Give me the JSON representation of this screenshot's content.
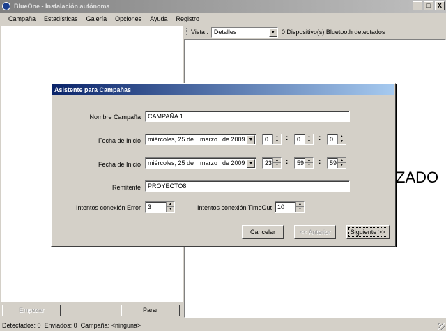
{
  "window": {
    "title": "BlueOne - Instalación autónoma",
    "controls": [
      "_",
      "□",
      "X"
    ]
  },
  "menu": [
    "Campaña",
    "Estadísticas",
    "Galería",
    "Opciones",
    "Ayuda",
    "Registro"
  ],
  "left_panel": {
    "start_button": "Empezar",
    "stop_button": "Parar"
  },
  "toolbar": {
    "vista_label": "Vista :",
    "vista_value": "Detalles",
    "devices_text": "0 Dispositivo(s) Bluetooth detectados"
  },
  "right_panel": {
    "background_text": "ZADO"
  },
  "dialog": {
    "title": "Asistente para Campañas",
    "nombre_label": "Nombre Campaña",
    "nombre_value": "CAMPAÑA 1",
    "fecha_inicio_label": "Fecha de Inicio",
    "fecha_inicio": {
      "weekday": "miércoles, 25 de",
      "month": "marzo",
      "year": "de 2009",
      "hour": "0",
      "minute": "0",
      "second": "0"
    },
    "fecha_fin_label": "Fecha de Inicio",
    "fecha_fin": {
      "weekday": "miércoles, 25 de",
      "month": "marzo",
      "year": "de 2009",
      "hour": "23",
      "minute": "59",
      "second": "59"
    },
    "remitente_label": "Remitente",
    "remitente_value": "PROYECTO8",
    "intentos_error_label": "Intentos conexión Error",
    "intentos_error_value": "3",
    "intentos_timeout_label": "Intentos conexión TimeOut",
    "intentos_timeout_value": "10",
    "cancel_button": "Cancelar",
    "prev_button": "<< Anterior",
    "next_button": "Siguiente >>"
  },
  "status": {
    "detectados_label": "Detectados:",
    "detectados_value": "0",
    "enviados_label": "Enviados:",
    "enviados_value": "0",
    "campana_label": "Campaña:",
    "campana_value": "<ninguna>"
  }
}
